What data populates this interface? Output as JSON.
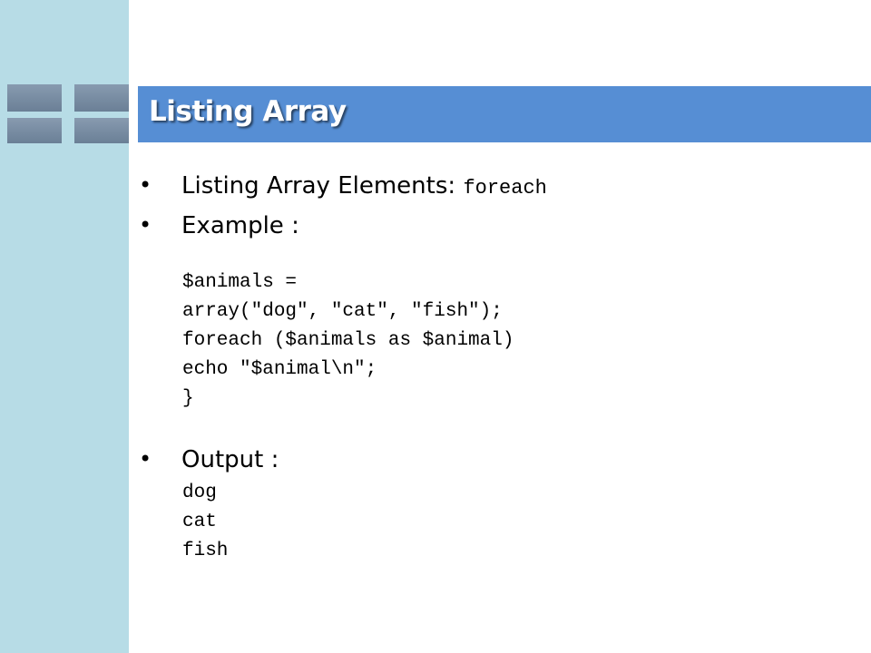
{
  "slide": {
    "title": "Listing Array",
    "bullets": [
      {
        "label": "Listing Array Elements: ",
        "code": "foreach"
      },
      {
        "label": "Example :"
      },
      {
        "label": "Output :"
      }
    ],
    "example_code": [
      "$animals =",
      "array(\"dog\", \"cat\", \"fish\");",
      "foreach ($animals as $animal)",
      "echo \"$animal\\n\";",
      "}"
    ],
    "output_lines": [
      "dog",
      "cat",
      "fish"
    ],
    "colors": {
      "sidebar": "#b7dce6",
      "title_bar": "#568ed4",
      "title_text": "#ffffff"
    }
  }
}
